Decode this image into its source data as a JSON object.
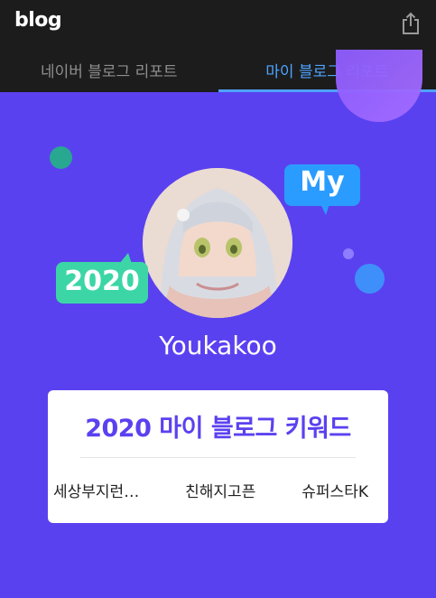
{
  "app": {
    "logo": "blog"
  },
  "tabs": [
    {
      "label": "네이버 블로그 리포트",
      "active": false
    },
    {
      "label": "마이 블로그 리포트",
      "active": true
    }
  ],
  "header": {
    "share_icon": "share-icon"
  },
  "profile": {
    "badge_my": "My",
    "badge_year": "2020",
    "username": "Youkakoo"
  },
  "keywords_card": {
    "title": "2020 마이 블로그 키워드",
    "keywords": [
      "세상부지런…",
      "친해지고픈",
      "슈퍼스타K"
    ]
  },
  "colors": {
    "background": "#5a41f0",
    "accent_blue": "#4ea3ff",
    "badge_my": "#2b9cff",
    "badge_year": "#3cd6a6",
    "title_purple": "#5a41f0"
  }
}
